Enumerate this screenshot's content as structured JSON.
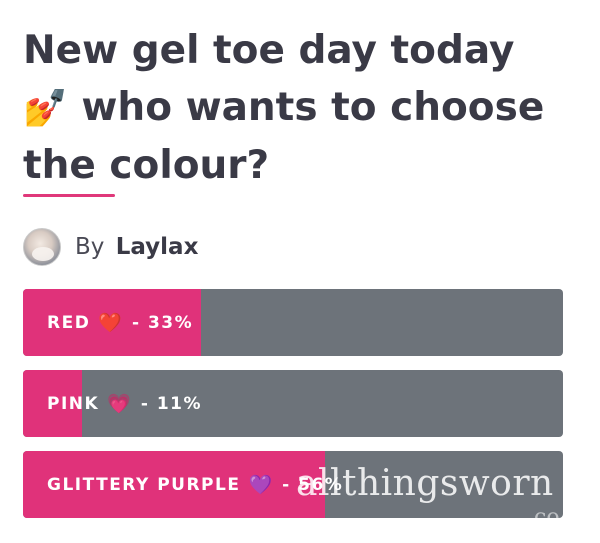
{
  "post": {
    "title_line1": "New gel toe day today",
    "title_emoji": "💅",
    "title_line2": " who wants to choose",
    "title_line3": "the colour?",
    "author_prefix": "By",
    "author_name": "Laylax"
  },
  "poll": {
    "accent_color": "#e0327a",
    "track_color": "#6d737a",
    "options": [
      {
        "label": "RED",
        "emoji": "❤️",
        "percent_text": "- 33%",
        "percent": 33
      },
      {
        "label": "PINK",
        "emoji": "💗",
        "percent_text": "- 11%",
        "percent": 11
      },
      {
        "label": "GLITTERY PURPLE",
        "emoji": "💜",
        "percent_text": "- 56%",
        "percent": 56
      }
    ]
  },
  "watermark": {
    "text": "allthingsworn",
    "sub": "co"
  }
}
